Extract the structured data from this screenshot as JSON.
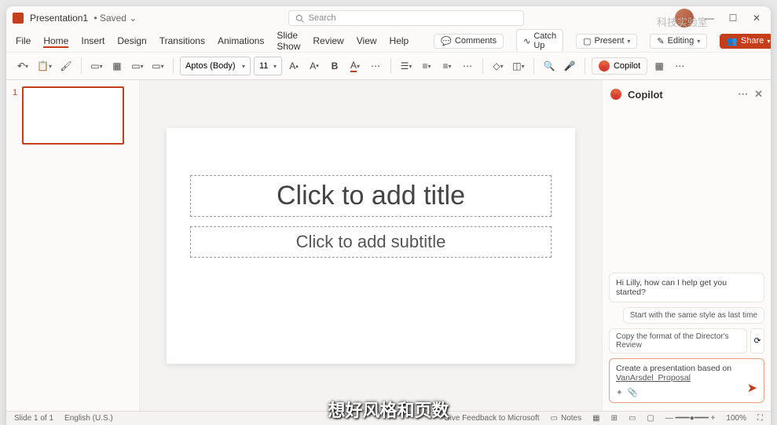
{
  "title": {
    "doc": "Presentation1",
    "state": "Saved"
  },
  "search": {
    "placeholder": "Search"
  },
  "watermark": "科技实验室",
  "menu": {
    "items": [
      "File",
      "Home",
      "Insert",
      "Design",
      "Transitions",
      "Animations",
      "Slide Show",
      "Review",
      "View",
      "Help"
    ],
    "active": 1
  },
  "topbuttons": {
    "comments": "Comments",
    "catchup": "Catch Up",
    "present": "Present",
    "editing": "Editing",
    "share": "Share"
  },
  "ribbon": {
    "font": "Aptos (Body)",
    "size": "11",
    "copilot": "Copilot"
  },
  "thumbs": {
    "n1": "1"
  },
  "slide": {
    "title": "Click to add title",
    "subtitle": "Click to add subtitle"
  },
  "copilot": {
    "title": "Copilot",
    "greeting": "Hi Lilly, how can I help get you started?",
    "sugg1": "Start with the same style as last time",
    "sugg2": "Copy the format of the Director's Review",
    "prompt_prefix": "Create a presentation based on",
    "prompt_link": "VanArsdel_Proposal"
  },
  "status": {
    "slide": "Slide 1 of 1",
    "lang": "English (U.S.)",
    "feedback": "Give Feedback to Microsoft",
    "notes": "Notes",
    "zoom": "100%"
  },
  "caption": "想好风格和页数"
}
